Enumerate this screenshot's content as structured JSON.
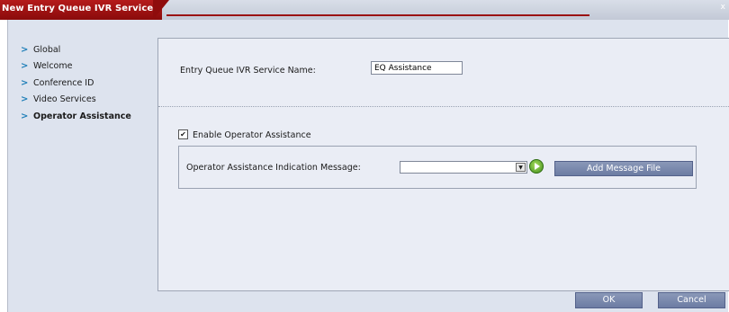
{
  "window": {
    "title": "New Entry Queue IVR Service",
    "close_symbol": "x"
  },
  "nav": {
    "items": [
      {
        "label": "Global"
      },
      {
        "label": "Welcome"
      },
      {
        "label": "Conference ID"
      },
      {
        "label": "Video Services"
      },
      {
        "label": "Operator Assistance"
      }
    ],
    "active_index": 4,
    "arrow_glyph": ">"
  },
  "form": {
    "service_name_label": "Entry Queue IVR Service Name:",
    "service_name_value": "EQ Assistance",
    "enable_operator_label": "Enable Operator Assistance",
    "enable_operator_checked": true,
    "indication_message_label": "Operator Assistance Indication Message:",
    "indication_message_value": "",
    "add_message_file_label": "Add Message File"
  },
  "footer": {
    "ok_label": "OK",
    "cancel_label": "Cancel"
  },
  "colors": {
    "title_red": "#a01414",
    "button_blue": "#7a89ae",
    "panel_bg": "#eaedf5",
    "window_bg": "#dde3ee"
  }
}
